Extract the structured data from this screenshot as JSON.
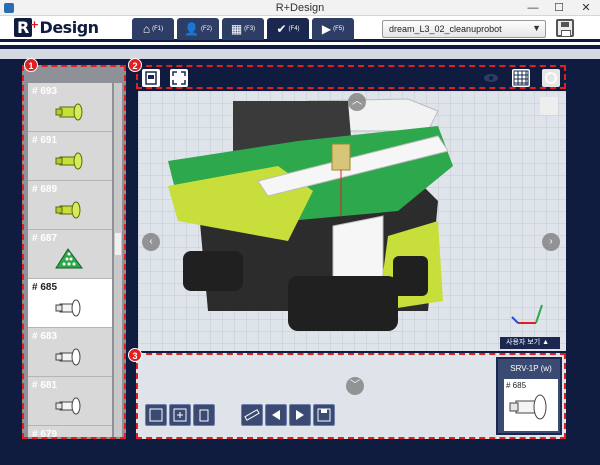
{
  "window": {
    "title": "R+Design",
    "minimize": "—",
    "maximize": "☐",
    "close": "✕"
  },
  "header": {
    "logo_r": "R",
    "logo_plus": "+",
    "logo_rest": "Design",
    "tabs": [
      {
        "icon": "⌂",
        "key": "(F1)"
      },
      {
        "icon": "👤",
        "key": "(F2)"
      },
      {
        "icon": "▦",
        "key": "(F3)"
      },
      {
        "icon": "✔",
        "key": "(F4)"
      },
      {
        "icon": "▶",
        "key": "(F5)"
      }
    ],
    "project": "dream_L3_02_cleanuprobot",
    "project_arrow": "▼"
  },
  "badges": {
    "parts": "1",
    "toolbar": "2",
    "bottom": "3"
  },
  "parts": [
    {
      "id": "# 693"
    },
    {
      "id": "# 691"
    },
    {
      "id": "# 689"
    },
    {
      "id": "# 687"
    },
    {
      "id": "# 685"
    },
    {
      "id": "# 683"
    },
    {
      "id": "# 681"
    },
    {
      "id": "# 679"
    }
  ],
  "viewport": {
    "view_label": "사용자 보기",
    "view_label_icon": "▲"
  },
  "selected_part": {
    "name": "SRV-1P (w)",
    "id": "# 685"
  },
  "colors": {
    "navy": "#0f1c3f",
    "accent_red": "#e02020",
    "lime": "#c8de3b",
    "green": "#2ea84c"
  }
}
